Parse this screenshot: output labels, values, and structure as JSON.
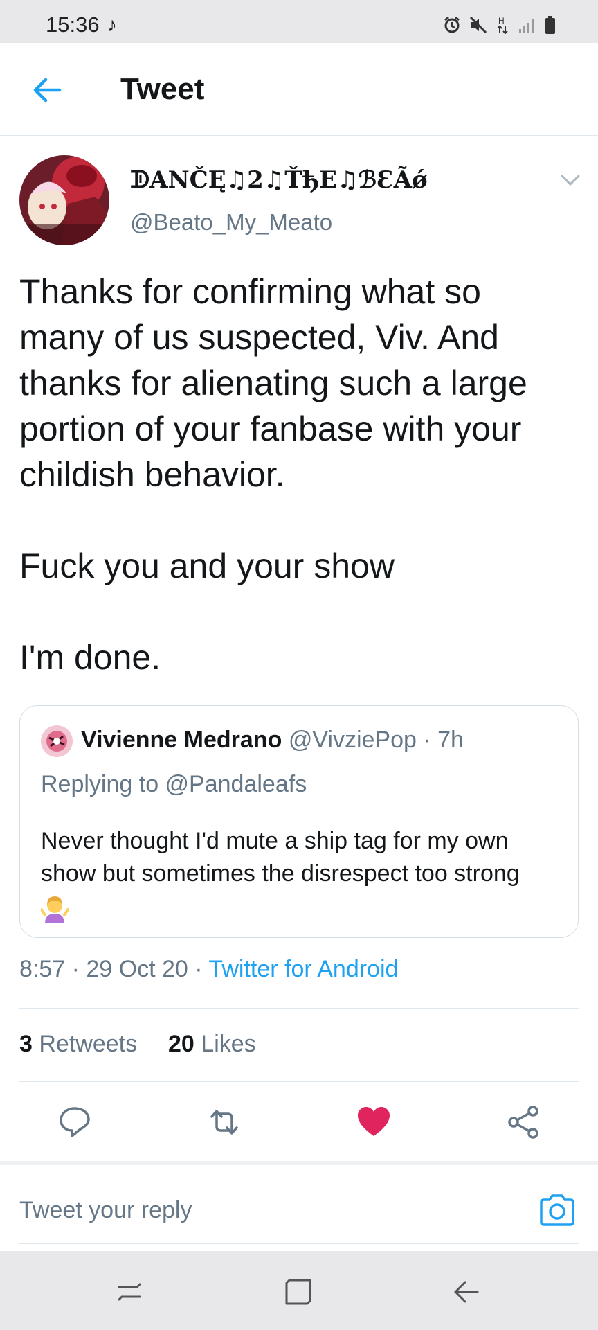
{
  "status_bar": {
    "time": "15:36",
    "tiktok_glyph": "♪",
    "icons": [
      "alarm-icon",
      "mute-icon",
      "data-icon",
      "signal-icon",
      "battery-icon"
    ]
  },
  "header": {
    "title": "Tweet",
    "back_icon": "arrow-left-icon"
  },
  "tweet": {
    "author": {
      "display_name": "ᗫANČĘ♫2♫ŤђE♫ℬƐÃǿ",
      "handle": "@Beato_My_Meato"
    },
    "text": "Thanks for confirming what so many of us suspected, Viv. And thanks for alienating such a large portion of your fanbase with your childish behavior.\n\nFuck you and your show\n\nI'm done.",
    "quoted": {
      "name": "Vivienne Medrano",
      "handle_time": "@VivziePop · 7h",
      "replying_to": "Replying to @Pandaleafs",
      "text": "Never thought I'd mute a ship tag for my own show but sometimes the disrespect too strong",
      "emoji": "woman-shrugging-emoji"
    },
    "meta": {
      "time_date": "8:57 · 29 Oct 20 · ",
      "client": "Twitter for Android"
    },
    "stats": {
      "retweets_count": "3",
      "retweets_label": "Retweets",
      "likes_count": "20",
      "likes_label": "Likes"
    }
  },
  "actions": [
    "reply-icon",
    "retweet-icon",
    "like-icon",
    "share-icon"
  ],
  "reply_bar": {
    "placeholder": "Tweet your reply"
  },
  "nav_bar": [
    "recents-icon",
    "home-icon",
    "back-icon"
  ],
  "colors": {
    "accent": "#1da1f2",
    "like": "#e0245e",
    "text": "#14171a",
    "secondary": "#657786"
  }
}
